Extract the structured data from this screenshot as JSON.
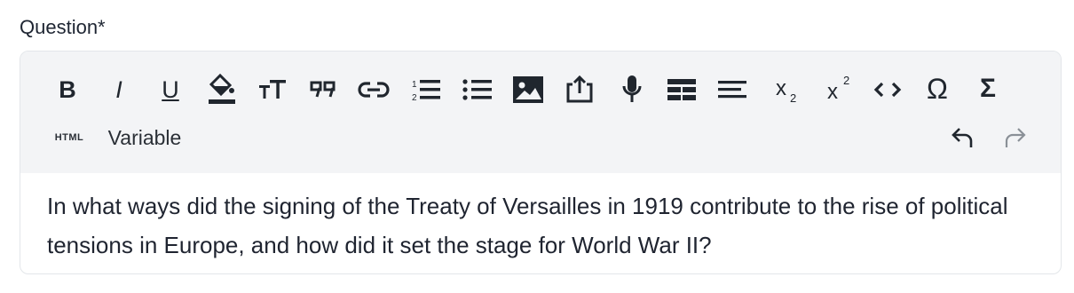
{
  "field": {
    "label": "Question*"
  },
  "toolbar": {
    "bold": "B",
    "italic": "I",
    "underline": "U",
    "html_label": "HTML",
    "variable_label": "Variable"
  },
  "content": {
    "text": "In what ways did the signing of the Treaty of Versailles in 1919 contribute to the rise of political tensions in Europe, and how did it set the stage for World War II?"
  },
  "icons": [
    "bold-icon",
    "italic-icon",
    "underline-icon",
    "fill-color-icon",
    "font-size-icon",
    "quote-icon",
    "link-icon",
    "ordered-list-icon",
    "unordered-list-icon",
    "image-icon",
    "upload-icon",
    "microphone-icon",
    "table-icon",
    "align-icon",
    "subscript-icon",
    "superscript-icon",
    "code-icon",
    "omega-icon",
    "sigma-icon",
    "undo-icon",
    "redo-icon"
  ],
  "colors": {
    "toolbar_bg": "#f3f4f6",
    "text": "#1f2430",
    "disabled": "#8a9097"
  }
}
